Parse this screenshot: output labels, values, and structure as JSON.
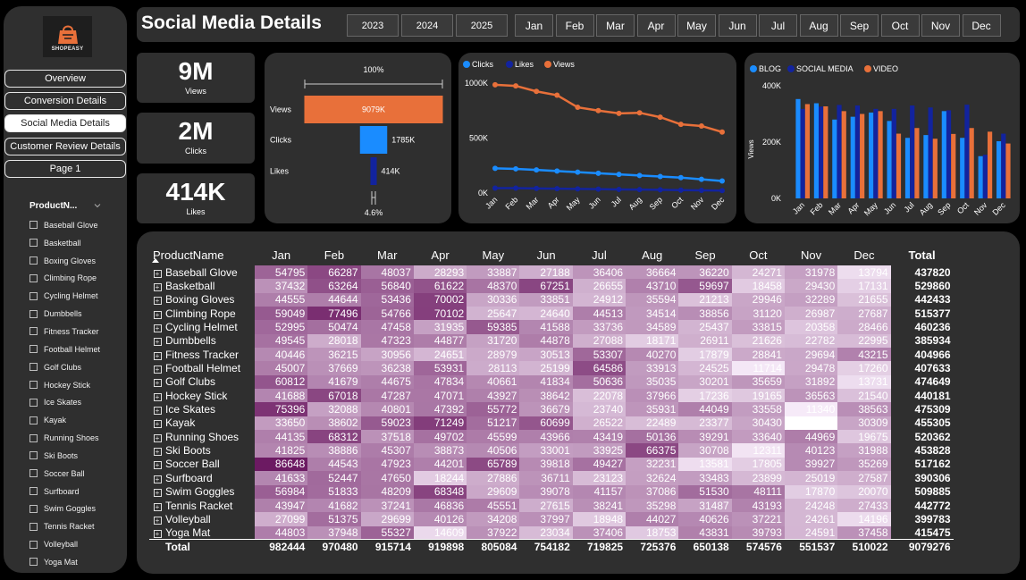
{
  "sidebar": {
    "logo_text": "SHOPEASY",
    "nav": [
      {
        "label": "Overview",
        "active": false
      },
      {
        "label": "Conversion Details",
        "active": false
      },
      {
        "label": "Social Media Details",
        "active": true
      },
      {
        "label": "Customer Review Details",
        "active": false
      },
      {
        "label": "Page 1",
        "active": false
      }
    ],
    "slicer_title": "ProductN...",
    "products": [
      "Baseball Glove",
      "Basketball",
      "Boxing Gloves",
      "Climbing Rope",
      "Cycling Helmet",
      "Dumbbells",
      "Fitness Tracker",
      "Football Helmet",
      "Golf Clubs",
      "Hockey Stick",
      "Ice Skates",
      "Kayak",
      "Running Shoes",
      "Ski Boots",
      "Soccer Ball",
      "Surfboard",
      "Swim Goggles",
      "Tennis Racket",
      "Volleyball",
      "Yoga Mat"
    ]
  },
  "header": {
    "title": "Social Media Details",
    "years": [
      "2023",
      "2024",
      "2025"
    ],
    "months": [
      "Jan",
      "Feb",
      "Mar",
      "Apr",
      "May",
      "Jun",
      "Jul",
      "Aug",
      "Sep",
      "Oct",
      "Nov",
      "Dec"
    ]
  },
  "kpis": [
    {
      "value": "9M",
      "label": "Views"
    },
    {
      "value": "2M",
      "label": "Clicks"
    },
    {
      "value": "414K",
      "label": "Likes"
    }
  ],
  "colors": {
    "views": "#e8703a",
    "clicks": "#1a8cff",
    "likes": "#12239e",
    "blog": "#1a8cff",
    "social": "#12239e",
    "video": "#e8703a",
    "panel": "#2f2f2f"
  },
  "chart_data": [
    {
      "type": "bar",
      "subtype": "funnel",
      "categories": [
        "Views",
        "Clicks",
        "Likes"
      ],
      "values": [
        9079,
        1785,
        414
      ],
      "value_labels": [
        "9079K",
        "1785K",
        "414K"
      ],
      "top_label": "100%",
      "bottom_label": "4.6%"
    },
    {
      "type": "line",
      "x": [
        "Jan",
        "Feb",
        "Mar",
        "Apr",
        "May",
        "Jun",
        "Jul",
        "Aug",
        "Sep",
        "Oct",
        "Nov",
        "Dec"
      ],
      "series": [
        {
          "name": "Clicks",
          "values": [
            225,
            220,
            210,
            200,
            190,
            180,
            170,
            160,
            150,
            140,
            125,
            110
          ]
        },
        {
          "name": "Likes",
          "values": [
            45,
            45,
            42,
            40,
            38,
            36,
            33,
            31,
            29,
            26,
            24,
            22
          ]
        },
        {
          "name": "Views",
          "values": [
            985,
            975,
            925,
            890,
            780,
            750,
            725,
            730,
            690,
            625,
            610,
            555
          ]
        }
      ],
      "yticks": [
        "0K",
        "500K",
        "1000K"
      ],
      "ylim": [
        0,
        1000
      ],
      "legend": "top-left"
    },
    {
      "type": "bar",
      "categories": [
        "Jan",
        "Feb",
        "Mar",
        "Apr",
        "May",
        "Jun",
        "Jul",
        "Aug",
        "Sep",
        "Oct",
        "Nov",
        "Dec"
      ],
      "series": [
        {
          "name": "BLOG",
          "values": [
            353,
            338,
            280,
            290,
            305,
            275,
            215,
            225,
            310,
            215,
            150,
            203
          ]
        },
        {
          "name": "SOCIAL MEDIA",
          "values": [
            318,
            326,
            332,
            330,
            318,
            318,
            330,
            323,
            313,
            333,
            155,
            230
          ]
        },
        {
          "name": "VIDEO",
          "values": [
            335,
            327,
            310,
            300,
            310,
            230,
            250,
            212,
            229,
            250,
            237,
            195
          ]
        }
      ],
      "ylabel": "Views",
      "yticks": [
        "0K",
        "200K",
        "400K"
      ],
      "ylim": [
        0,
        400
      ],
      "legend": "top-left"
    }
  ],
  "matrix": {
    "name_header": "ProductName",
    "total_header": "Total",
    "total_label": "Total",
    "rows": [
      {
        "name": "Baseball Glove",
        "values": [
          54795,
          66287,
          48037,
          28293,
          33887,
          27188,
          36406,
          36664,
          36220,
          24271,
          31978,
          13794
        ],
        "total": 437820
      },
      {
        "name": "Basketball",
        "values": [
          37432,
          63264,
          56840,
          61622,
          48370,
          67251,
          26655,
          43710,
          59697,
          18458,
          29430,
          17131
        ],
        "total": 529860
      },
      {
        "name": "Boxing Gloves",
        "values": [
          44555,
          44644,
          53436,
          70002,
          30336,
          33851,
          24912,
          35594,
          21213,
          29946,
          32289,
          21655
        ],
        "total": 442433
      },
      {
        "name": "Climbing Rope",
        "values": [
          59049,
          77496,
          54766,
          70102,
          25647,
          24640,
          44513,
          34514,
          38856,
          31120,
          26987,
          27687
        ],
        "total": 515377
      },
      {
        "name": "Cycling Helmet",
        "values": [
          52995,
          50474,
          47458,
          31935,
          59385,
          41588,
          33736,
          34589,
          25437,
          33815,
          20358,
          28466
        ],
        "total": 460236
      },
      {
        "name": "Dumbbells",
        "values": [
          49545,
          28018,
          47323,
          44877,
          31720,
          44878,
          27088,
          18171,
          26911,
          21626,
          22782,
          22995
        ],
        "total": 385934
      },
      {
        "name": "Fitness Tracker",
        "values": [
          40446,
          36215,
          30956,
          24651,
          28979,
          30513,
          53307,
          40270,
          17879,
          28841,
          29694,
          43215
        ],
        "total": 404966
      },
      {
        "name": "Football Helmet",
        "values": [
          45007,
          37669,
          36238,
          53931,
          28113,
          25199,
          64586,
          33913,
          24525,
          11714,
          29478,
          17260
        ],
        "total": 407633
      },
      {
        "name": "Golf Clubs",
        "values": [
          60812,
          41679,
          44675,
          47834,
          40661,
          41834,
          50636,
          35035,
          30201,
          35659,
          31892,
          13731
        ],
        "total": 474649
      },
      {
        "name": "Hockey Stick",
        "values": [
          41688,
          67018,
          47287,
          47071,
          43927,
          38642,
          22078,
          37966,
          17236,
          19165,
          36563,
          21540
        ],
        "total": 440181
      },
      {
        "name": "Ice Skates",
        "values": [
          75396,
          32088,
          40801,
          47392,
          55772,
          36679,
          23740,
          35931,
          44049,
          33558,
          11340,
          38563
        ],
        "total": 475309
      },
      {
        "name": "Kayak",
        "values": [
          33650,
          38602,
          59023,
          71249,
          51217,
          60699,
          26522,
          22489,
          23377,
          30430,
          null,
          30309
        ],
        "total": 455305
      },
      {
        "name": "Running Shoes",
        "values": [
          44135,
          68312,
          37518,
          49702,
          45599,
          43966,
          43419,
          50136,
          39291,
          33640,
          44969,
          19675
        ],
        "total": 520362
      },
      {
        "name": "Ski Boots",
        "values": [
          41825,
          38886,
          45307,
          38873,
          40506,
          33001,
          33925,
          66375,
          30708,
          12311,
          40123,
          31988
        ],
        "total": 453828
      },
      {
        "name": "Soccer Ball",
        "values": [
          86648,
          44543,
          47923,
          44201,
          65789,
          39818,
          49427,
          32231,
          13581,
          17805,
          39927,
          35269
        ],
        "total": 517162
      },
      {
        "name": "Surfboard",
        "values": [
          41633,
          52447,
          47650,
          18244,
          27886,
          36711,
          23123,
          32624,
          33483,
          23899,
          25019,
          27587
        ],
        "total": 390306
      },
      {
        "name": "Swim Goggles",
        "values": [
          56984,
          51833,
          48209,
          68348,
          29609,
          39078,
          41157,
          37086,
          51530,
          48111,
          17870,
          20070
        ],
        "total": 509885
      },
      {
        "name": "Tennis Racket",
        "values": [
          43947,
          41682,
          37241,
          46836,
          45551,
          27615,
          38241,
          35298,
          31487,
          43193,
          24248,
          27433
        ],
        "total": 442772
      },
      {
        "name": "Volleyball",
        "values": [
          27099,
          51375,
          29699,
          40126,
          34208,
          37997,
          18948,
          44027,
          40626,
          37221,
          24261,
          14196
        ],
        "total": 399783
      },
      {
        "name": "Yoga Mat",
        "values": [
          44803,
          37948,
          55327,
          14609,
          37922,
          23034,
          37406,
          18753,
          43831,
          39793,
          24591,
          37458
        ],
        "total": 415475
      }
    ],
    "totals": [
      982444,
      970480,
      915714,
      919898,
      805084,
      754182,
      719825,
      725376,
      650138,
      574576,
      551537,
      510022
    ],
    "grand_total": 9079276
  }
}
